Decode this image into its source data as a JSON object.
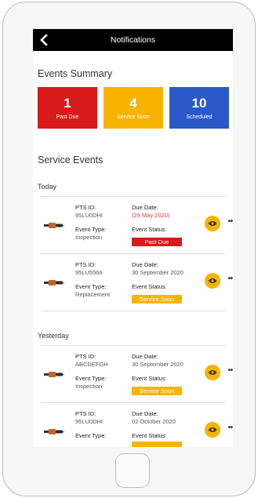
{
  "header": {
    "title": "Notifications"
  },
  "summary": {
    "title": "Events Summary",
    "tiles": [
      {
        "count": "1",
        "label": "Past Due",
        "color": "#d91a1a"
      },
      {
        "count": "4",
        "label": "Service Soon",
        "color": "#f6b400"
      },
      {
        "count": "10",
        "label": "Scheduled",
        "color": "#2a58c8"
      }
    ]
  },
  "service_events": {
    "title": "Service Events",
    "groups": [
      {
        "label": "Today",
        "events": [
          {
            "pts_label": "PTS ID:",
            "pts_id": "95LU0DHI",
            "due_label": "Due Date:",
            "due_date": "(29 May 2020)",
            "type_label": "Event Type:",
            "type": "Inspection",
            "status_label": "Event Status:",
            "status": "Past Due",
            "status_color": "#d91a1a"
          },
          {
            "pts_label": "PTS ID:",
            "pts_id": "95LU5566",
            "due_label": "Due Date:",
            "due_date": "30 September 2020",
            "type_label": "Event Type:",
            "type": "Replacement",
            "status_label": "Event Status:",
            "status": "Service Soon",
            "status_color": "#f6b400"
          }
        ]
      },
      {
        "label": "Yesterday",
        "events": [
          {
            "pts_label": "PTS ID:",
            "pts_id": "ABCDEFGH",
            "due_label": "Due Date:",
            "due_date": "30 September 2020",
            "type_label": "Event Type:",
            "type": "Inspection",
            "status_label": "Event Status:",
            "status": "Service Soon",
            "status_color": "#f6b400"
          },
          {
            "pts_label": "PTS ID:",
            "pts_id": "95LU0DHI",
            "due_label": "Due Date:",
            "due_date": "02 October 2020",
            "type_label": "Event Type:",
            "type": "",
            "status_label": "Event Status:",
            "status": "",
            "status_color": "#f6b400"
          }
        ]
      }
    ]
  },
  "icons": {
    "back": "back-arrow-icon",
    "view": "eye-icon",
    "more": "more-dots-icon",
    "item": "spark-plug-icon"
  }
}
